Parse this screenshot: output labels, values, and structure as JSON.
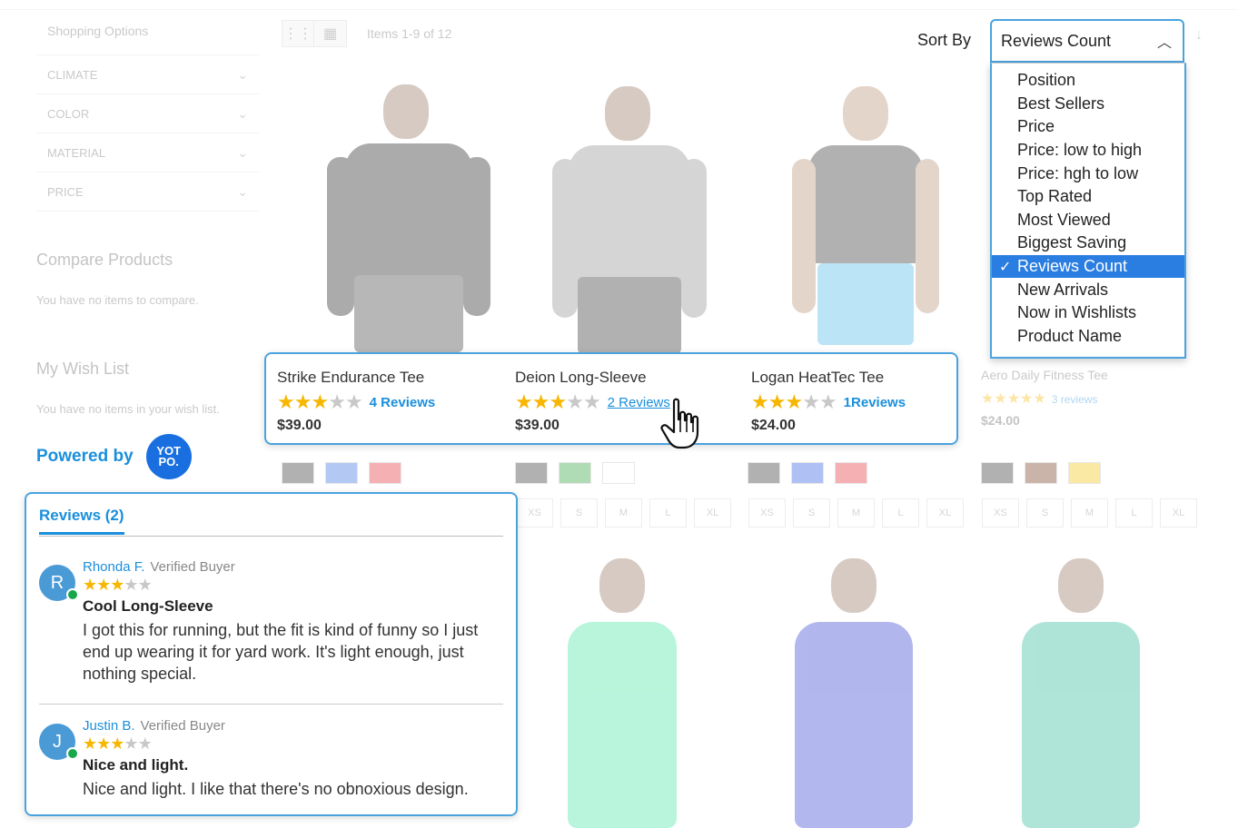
{
  "sidebar": {
    "shopping_options": "Shopping Options",
    "filters": [
      {
        "label": "CLIMATE"
      },
      {
        "label": "COLOR"
      },
      {
        "label": "MATERIAL"
      },
      {
        "label": "PRICE"
      }
    ],
    "compare_title": "Compare Products",
    "compare_note": "You have no items to compare.",
    "wishlist_title": "My Wish List",
    "wishlist_note": "You have no items in your wish list."
  },
  "toolbar": {
    "item_count": "Items 1-9 of 12",
    "sort_label": "Sort By",
    "sort_value": "Reviews Count",
    "sort_options": [
      "Position",
      "Best Sellers",
      "Price",
      "Price: low to high",
      "Price: hgh to low",
      "Top Rated",
      "Most Viewed",
      "Biggest Saving",
      "Reviews Count",
      "New Arrivals",
      "Now in Wishlists",
      "Product Name"
    ],
    "selected_index": 8
  },
  "products": [
    {
      "name": "Strike Endurance Tee",
      "rating": 3,
      "reviews": "4 Reviews",
      "price": "$39.00"
    },
    {
      "name": "Deion Long-Sleeve",
      "rating": 3,
      "reviews": "2 Reviews",
      "price": "$39.00"
    },
    {
      "name": "Logan HeatTec Tee",
      "rating": 3,
      "reviews": "1Reviews",
      "price": "$24.00"
    }
  ],
  "ghost_product": {
    "name": "Aero Daily Fitness Tee",
    "reviews": "3 reviews",
    "price": "$24.00"
  },
  "sizes": [
    "XS",
    "S",
    "M",
    "L",
    "XL"
  ],
  "swatch_colors": [
    [
      "#222222",
      "#2b63e0",
      "#e4202a"
    ],
    [
      "#222222",
      "#1e9a2e",
      "#ffffff"
    ],
    [
      "#222222",
      "#1d4fe0",
      "#e4202a"
    ],
    [
      "#222222",
      "#6b2a10",
      "#f2c200"
    ]
  ],
  "powered_by": {
    "text": "Powered by",
    "logo": "YOT PO."
  },
  "reviews_panel": {
    "tab": "Reviews (2)",
    "items": [
      {
        "initial": "R",
        "author": "Rhonda F.",
        "badge": "Verified Buyer",
        "rating": 3,
        "title": "Cool Long-Sleeve",
        "text": "I got this for running, but the fit is kind of funny so I just end up wearing it for yard work. It's light enough, just nothing special."
      },
      {
        "initial": "J",
        "author": "Justin B.",
        "badge": "Verified Buyer",
        "rating": 3,
        "title": "Nice and light.",
        "text": "Nice and light. I like that there's no obnoxious design."
      }
    ]
  },
  "colors": {
    "accent": "#1a8fdc",
    "border": "#4aa3df",
    "star": "#f7b600",
    "selected": "#2a7de1"
  }
}
